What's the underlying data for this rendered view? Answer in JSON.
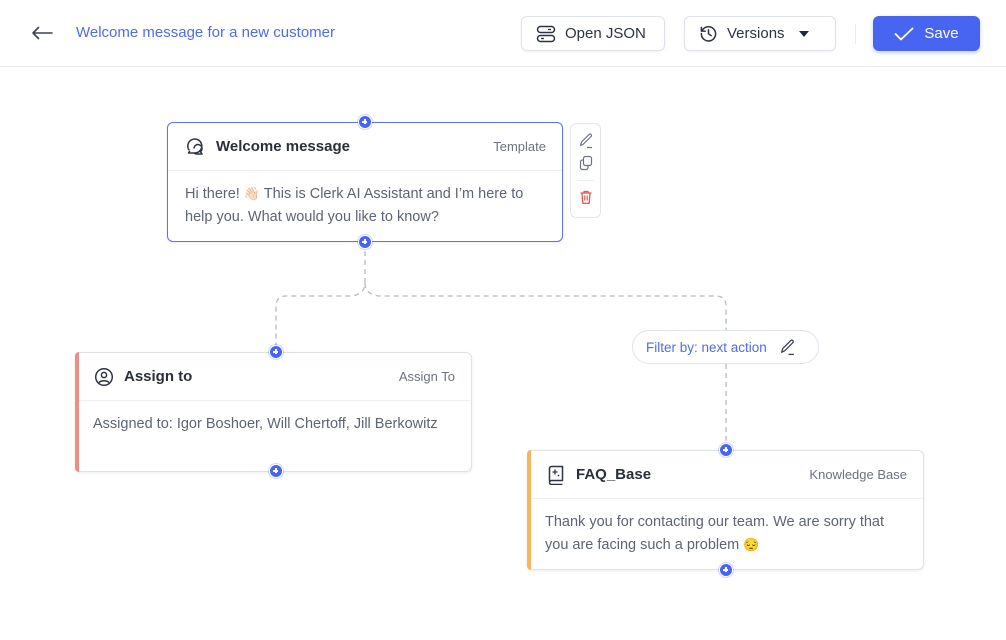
{
  "header": {
    "back_icon": "arrow-left-icon",
    "title": "Welcome message for a new customer",
    "open_json_label": "Open JSON",
    "open_json_icon": "server-icon",
    "versions_label": "Versions",
    "versions_icon": "history-icon",
    "save_label": "Save",
    "save_icon": "check-icon",
    "accent_color": "#4765f0"
  },
  "nodes": [
    {
      "id": "welcome",
      "icon": "chat-bubbles-icon",
      "title": "Welcome message",
      "type": "Template",
      "body_pre": "Hi there! ",
      "body_emoji": "👋🏻",
      "body_post": " This is Clerk AI Assistant and I’m here to help you. What would you like to know?",
      "accent_color": "#5b73ee",
      "selected": true
    },
    {
      "id": "assign",
      "icon": "user-circle-icon",
      "title": "Assign to",
      "type": "Assign To",
      "body": "Assigned to: Igor Boshoer, Will Chertoff, Jill Berkowitz",
      "accent_color": "#ee8d84"
    },
    {
      "id": "faq",
      "icon": "book-sparkle-icon",
      "title": "FAQ_Base",
      "type": "Knowledge Base",
      "body_pre": "Thank you for contacting our team. We are sorry that you are facing such a problem ",
      "body_emoji": "😔",
      "accent_color": "#f7b45a"
    }
  ],
  "node_actions": [
    "edit-icon",
    "duplicate-icon",
    "delete-icon"
  ],
  "connections": [
    {
      "from": "welcome",
      "to": "assign"
    },
    {
      "from": "welcome",
      "to": "faq",
      "label": "Filter by: next action"
    }
  ]
}
